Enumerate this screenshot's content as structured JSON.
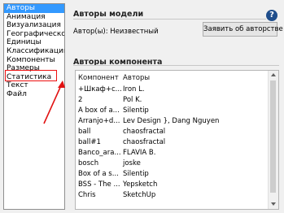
{
  "sidebar": {
    "items": [
      {
        "label": "Авторы",
        "selected": true
      },
      {
        "label": "Анимация",
        "selected": false
      },
      {
        "label": "Визуализация",
        "selected": false
      },
      {
        "label": "Географическое п",
        "selected": false
      },
      {
        "label": "Единицы",
        "selected": false
      },
      {
        "label": "Классификации",
        "selected": false
      },
      {
        "label": "Компоненты",
        "selected": false
      },
      {
        "label": "Размеры",
        "selected": false
      },
      {
        "label": "Статистика",
        "selected": false
      },
      {
        "label": "Текст",
        "selected": false
      },
      {
        "label": "Файл",
        "selected": false
      }
    ]
  },
  "model_authors": {
    "title": "Авторы модели",
    "author_label": "Автор(ы): Неизвестный",
    "report_button": "Заявить об авторстве"
  },
  "component_authors": {
    "title": "Авторы компонента",
    "columns": [
      "Компонент",
      "Авторы"
    ],
    "rows": [
      {
        "component": "+Шкаф+с...",
        "authors": "Iron L."
      },
      {
        "component": "2",
        "authors": "Pol K."
      },
      {
        "component": "A box of a...",
        "authors": "Silentip"
      },
      {
        "component": "Arranjo+d...",
        "authors": "Lev Design }, Dang Nguyen"
      },
      {
        "component": "ball",
        "authors": "chaosfractal"
      },
      {
        "component": "ball#1",
        "authors": "chaosfractal"
      },
      {
        "component": "Banco_ara...",
        "authors": "FLAVIA B."
      },
      {
        "component": "bosch",
        "authors": "joske"
      },
      {
        "component": "Box of a s...",
        "authors": "Silentip"
      },
      {
        "component": "BSS - The ...",
        "authors": "Yepsketch"
      },
      {
        "component": "Chris",
        "authors": "SketchUp"
      }
    ]
  },
  "colors": {
    "selection": "#3399ff",
    "annotation": "#e11111",
    "help": "#1f4e8c"
  },
  "icons": {
    "help": "question-icon"
  },
  "help_glyph": "?"
}
